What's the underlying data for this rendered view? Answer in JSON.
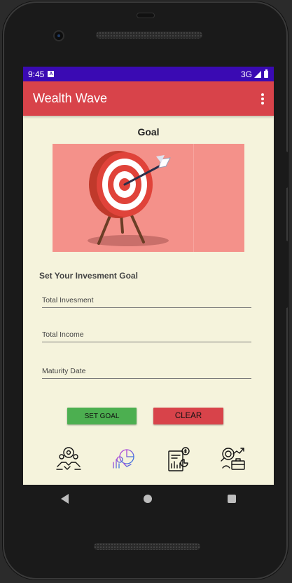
{
  "status_bar": {
    "time": "9:45",
    "notification_icon": "A",
    "network": "3G",
    "icons": [
      "signal-icon",
      "battery-icon"
    ]
  },
  "app_bar": {
    "title": "Wealth Wave",
    "menu_icon": "overflow-menu-icon"
  },
  "page": {
    "heading": "Goal",
    "banner_image": "target-arrow-illustration",
    "section_title": "Set Your Invesment Goal"
  },
  "form": {
    "total_investment": {
      "placeholder": "Total Invesment",
      "value": ""
    },
    "total_income": {
      "placeholder": "Total Income",
      "value": ""
    },
    "maturity_date": {
      "placeholder": "Maturity Date",
      "value": ""
    }
  },
  "buttons": {
    "set_goal": "SET GOAL",
    "clear": "CLEAR"
  },
  "bottom_icons": [
    "handshake-team-icon",
    "analytics-chart-icon",
    "financial-report-icon",
    "investment-search-icon"
  ],
  "colors": {
    "status_bar": "#3a0ab3",
    "app_bar": "#d8434a",
    "background": "#f5f3dc",
    "set_goal_button": "#4caf50",
    "clear_button": "#d8434a",
    "banner": "#f4918a"
  },
  "system_nav": [
    "back-icon",
    "home-icon",
    "recents-icon"
  ]
}
